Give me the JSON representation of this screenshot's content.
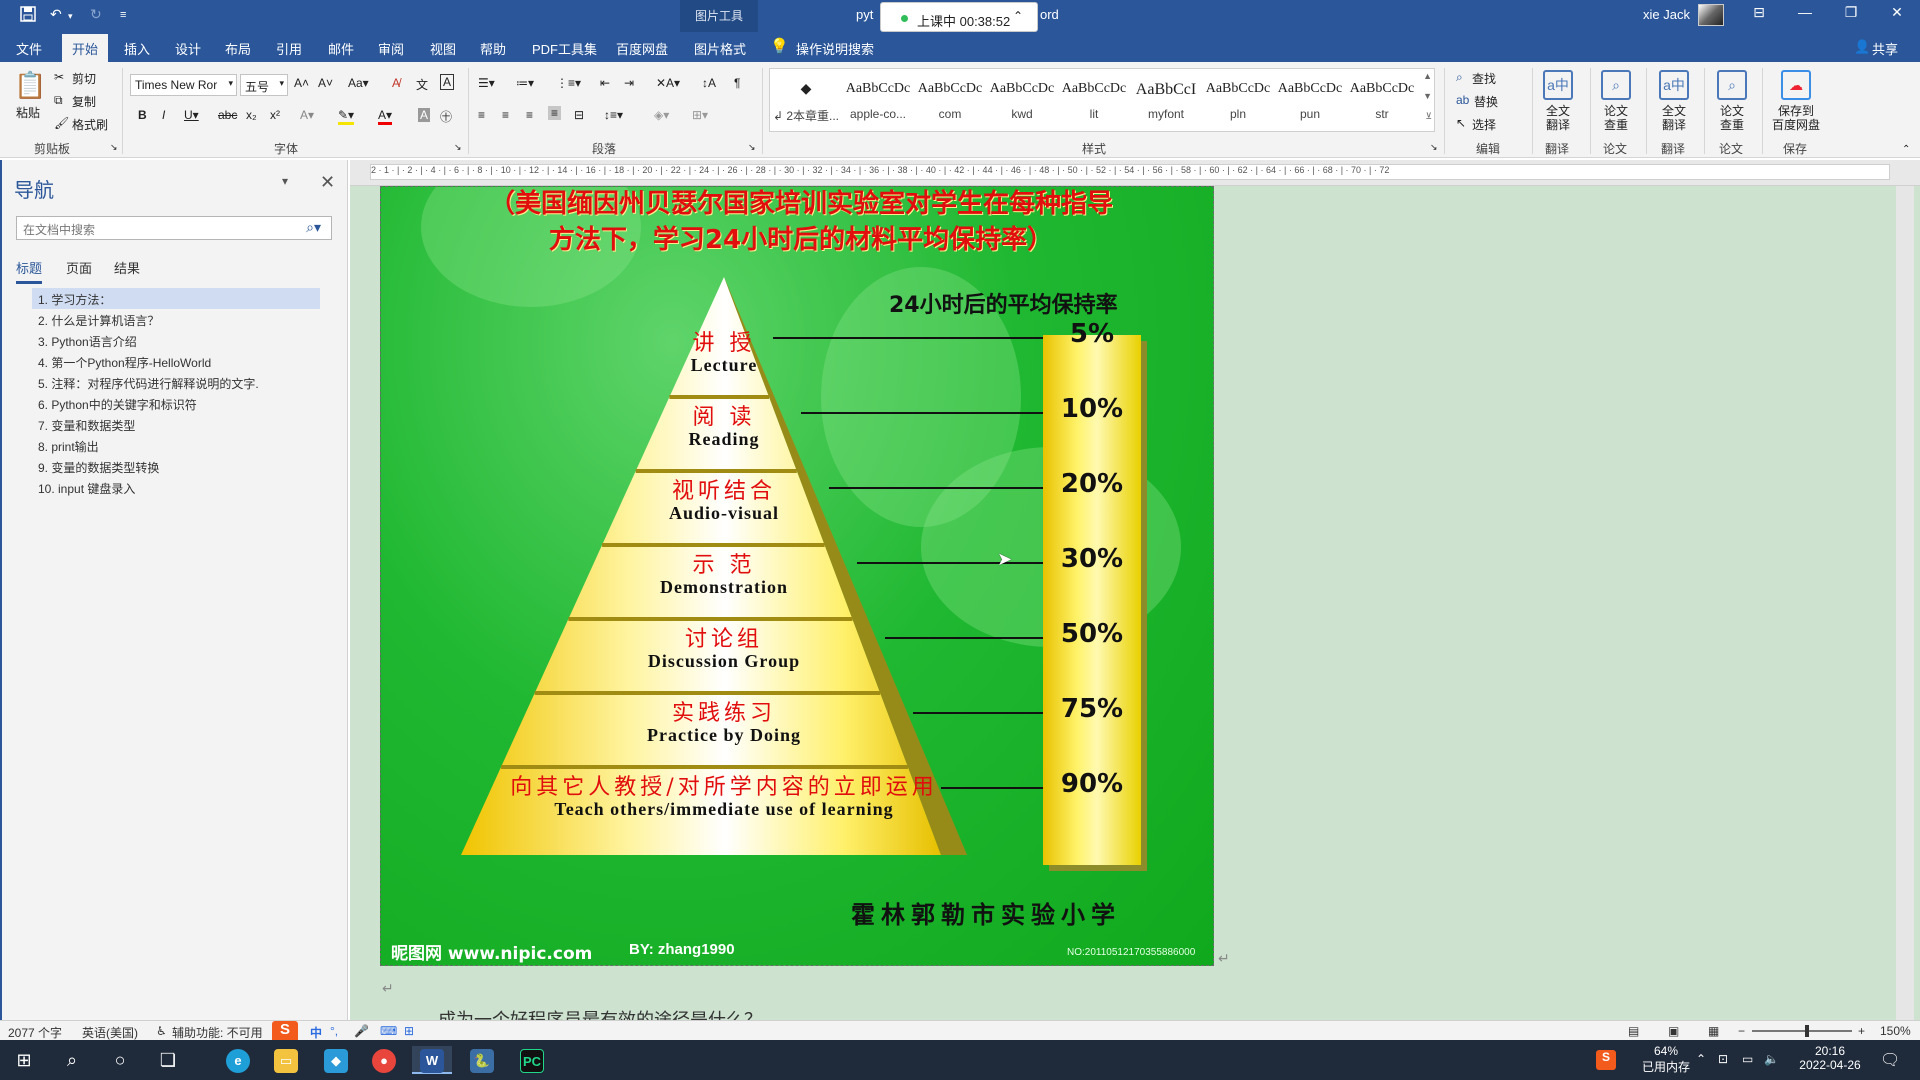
{
  "titlebar": {
    "context_tool": "图片工具",
    "doc_title_left": "pyt",
    "doc_title_right": "ord",
    "recording_label": "上课中 00:38:52",
    "user": "xie Jack",
    "qa": {
      "save_icon": "save-icon",
      "undo_icon": "undo-icon",
      "redo_icon": "redo-icon",
      "customize_icon": "customize-icon"
    }
  },
  "tabs": {
    "items": [
      "文件",
      "开始",
      "插入",
      "设计",
      "布局",
      "引用",
      "邮件",
      "审阅",
      "视图",
      "帮助",
      "PDF工具集",
      "百度网盘",
      "图片格式"
    ],
    "active": "开始",
    "tell_me": "操作说明搜索",
    "share": "共享"
  },
  "ribbon": {
    "clipboard": {
      "paste": "粘贴",
      "cut": "剪切",
      "copy": "复制",
      "format_painter": "格式刷",
      "group": "剪贴板"
    },
    "font": {
      "font_name": "Times New Ror",
      "font_size": "五号",
      "group": "字体"
    },
    "paragraph": {
      "group": "段落"
    },
    "styles": {
      "group": "样式",
      "items": [
        {
          "sample": "◆",
          "name": "↲ 2本章重..."
        },
        {
          "sample": "AaBbCcDc",
          "name": "apple-co..."
        },
        {
          "sample": "AaBbCcDc",
          "name": "com"
        },
        {
          "sample": "AaBbCcDc",
          "name": "kwd"
        },
        {
          "sample": "AaBbCcDc",
          "name": "lit"
        },
        {
          "sample": "AaBbCcI",
          "name": "myfont"
        },
        {
          "sample": "AaBbCcDc",
          "name": "pln"
        },
        {
          "sample": "AaBbCcDc",
          "name": "pun"
        },
        {
          "sample": "AaBbCcDc",
          "name": "str"
        }
      ]
    },
    "editing": {
      "find": "查找",
      "replace": "替换",
      "select": "选择",
      "group": "编辑"
    },
    "translate1": {
      "label": "全文\n翻译",
      "group": "翻译"
    },
    "paper_check1": {
      "label": "论文\n查重",
      "group": "论文"
    },
    "translate2": {
      "label": "全文\n翻译",
      "group": "翻译"
    },
    "paper_check2": {
      "label": "论文\n查重",
      "group": "论文"
    },
    "baidu_save": {
      "label": "保存到\n百度网盘",
      "group": "保存"
    }
  },
  "ruler": {
    "ticks": "2 · 1 · | · 2 · | · 4 · | · 6 · | · 8 · | · 10 · | · 12 · | · 14 · | · 16 · | · 18 · | · 20 · | · 22 · | · 24 · | · 26 · | · 28 · | · 30 · | · 32 · | · 34 · | · 36 · | · 38 · | · 40 · | · 42 · | · 44 · | · 46 · | · 48 · | · 50 · | · 52 · | · 54 · | · 56 · | · 58 · | · 60 · | · 62 · | · 64 · | · 66 · | · 68 · | · 70 · | · 72"
  },
  "nav": {
    "title": "导航",
    "search_placeholder": "在文档中搜索",
    "tabs": [
      "标题",
      "页面",
      "结果"
    ],
    "headings": [
      "1. 学习方法：",
      "2. 什么是计算机语言？",
      "3. Python语言介绍",
      "4. 第一个Python程序-HelloWorld",
      "5. 注释：对程序代码进行解释说明的文字.",
      "6. Python中的关键字和标识符",
      "7. 变量和数据类型",
      "8. print输出",
      "9. 变量的数据类型转换",
      "10. input 键盘录入"
    ],
    "selected_index": 0
  },
  "picture": {
    "subtitle_line1": "（美国缅因州贝瑟尔国家培训实验室对学生在每种指导",
    "subtitle_line2": "方法下，学习24小时后的材料平均保持率）",
    "rate_title": "24小时后的平均保持率",
    "school": "霍林郭勒市实验小学",
    "watermark": "昵图网 www.nipic.com",
    "byline": "BY: zhang1990",
    "serial": "NO:20110512170355886000",
    "levels": [
      {
        "zh": "讲 授",
        "en": "Lecture",
        "rate": 5,
        "rate_label": "5%"
      },
      {
        "zh": "阅 读",
        "en": "Reading",
        "rate": 10,
        "rate_label": "10%"
      },
      {
        "zh": "视听结合",
        "en": "Audio-visual",
        "rate": 20,
        "rate_label": "20%"
      },
      {
        "zh": "示 范",
        "en": "Demonstration",
        "rate": 30,
        "rate_label": "30%"
      },
      {
        "zh": "讨论组",
        "en": "Discussion Group",
        "rate": 50,
        "rate_label": "50%"
      },
      {
        "zh": "实践练习",
        "en": "Practice by Doing",
        "rate": 75,
        "rate_label": "75%"
      },
      {
        "zh": "向其它人教授/对所学内容的立即运用",
        "en": "Teach others/immediate use of learning",
        "rate": 90,
        "rate_label": "90%"
      }
    ]
  },
  "doc_body": {
    "next_line": "成为一个好程序员最有效的途径是什么？"
  },
  "statusbar": {
    "word_count": "2077 个字",
    "language": "英语(美国)",
    "accessibility": "辅助功能: 不可用",
    "ime": "中",
    "zoom": "150%"
  },
  "taskbar": {
    "memory_pct": "64%",
    "memory_label": "已用内存",
    "time": "20:16",
    "date": "2022-04-26"
  }
}
